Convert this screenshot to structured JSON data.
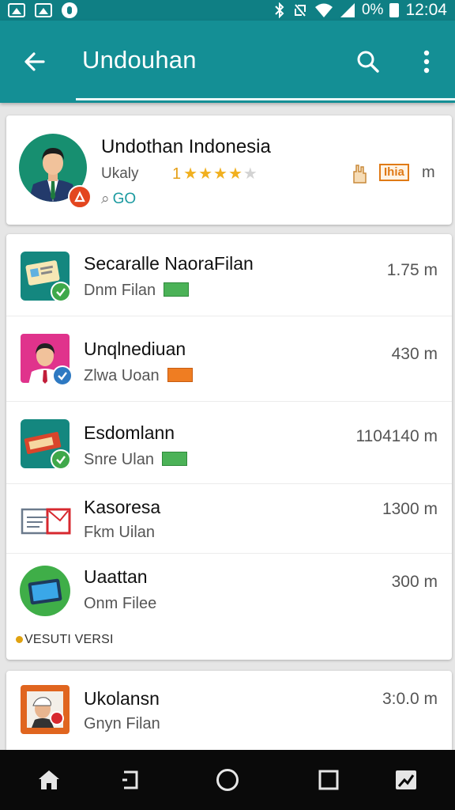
{
  "status_bar": {
    "battery": "0%",
    "time": "12:04"
  },
  "app_bar": {
    "title": "Undouhan"
  },
  "featured": {
    "title": "Undothan Indonesia",
    "subtitle": "Ukaly",
    "rating_text": "1",
    "rating_value": 4,
    "rating_max": 5,
    "action": "GO",
    "tag": "Ihia",
    "size_unit": "m"
  },
  "list": {
    "items": [
      {
        "title": "Secaralle NaoraFilan",
        "subtitle": "Dnm Filan",
        "size": "1.75 m",
        "icon": "id-card-icon",
        "status": "installed"
      },
      {
        "title": "Unqlnediuan",
        "subtitle": "Zlwa Uoan",
        "size": "430 m",
        "icon": "profile-avatar-icon",
        "status": "verified"
      },
      {
        "title": "Esdomlann",
        "subtitle": "Snre Ulan",
        "size": "1104140 m",
        "icon": "ticket-icon",
        "status": "installed"
      },
      {
        "title": "Kasoresa",
        "subtitle": "Fkm Uilan",
        "size": "1300 m",
        "icon": "envelope-icon",
        "status": "none"
      },
      {
        "title": "Uaattan",
        "subtitle": "Onm Filee",
        "size": "300 m",
        "icon": "tablet-icon",
        "status": "none"
      }
    ],
    "footer_label": "VESUTI VERSI"
  },
  "bottom_card": {
    "title": "Ukolansn",
    "subtitle": "Gnyn Filan",
    "size": "3:0.0 m",
    "icon": "photo-icon"
  },
  "colors": {
    "primary": "#148f95",
    "status_bar": "#0f7f84",
    "accent_teal": "#1b9aa0",
    "star": "#f1b01f",
    "check_green": "#3ea84a",
    "check_blue": "#2e79c2"
  }
}
